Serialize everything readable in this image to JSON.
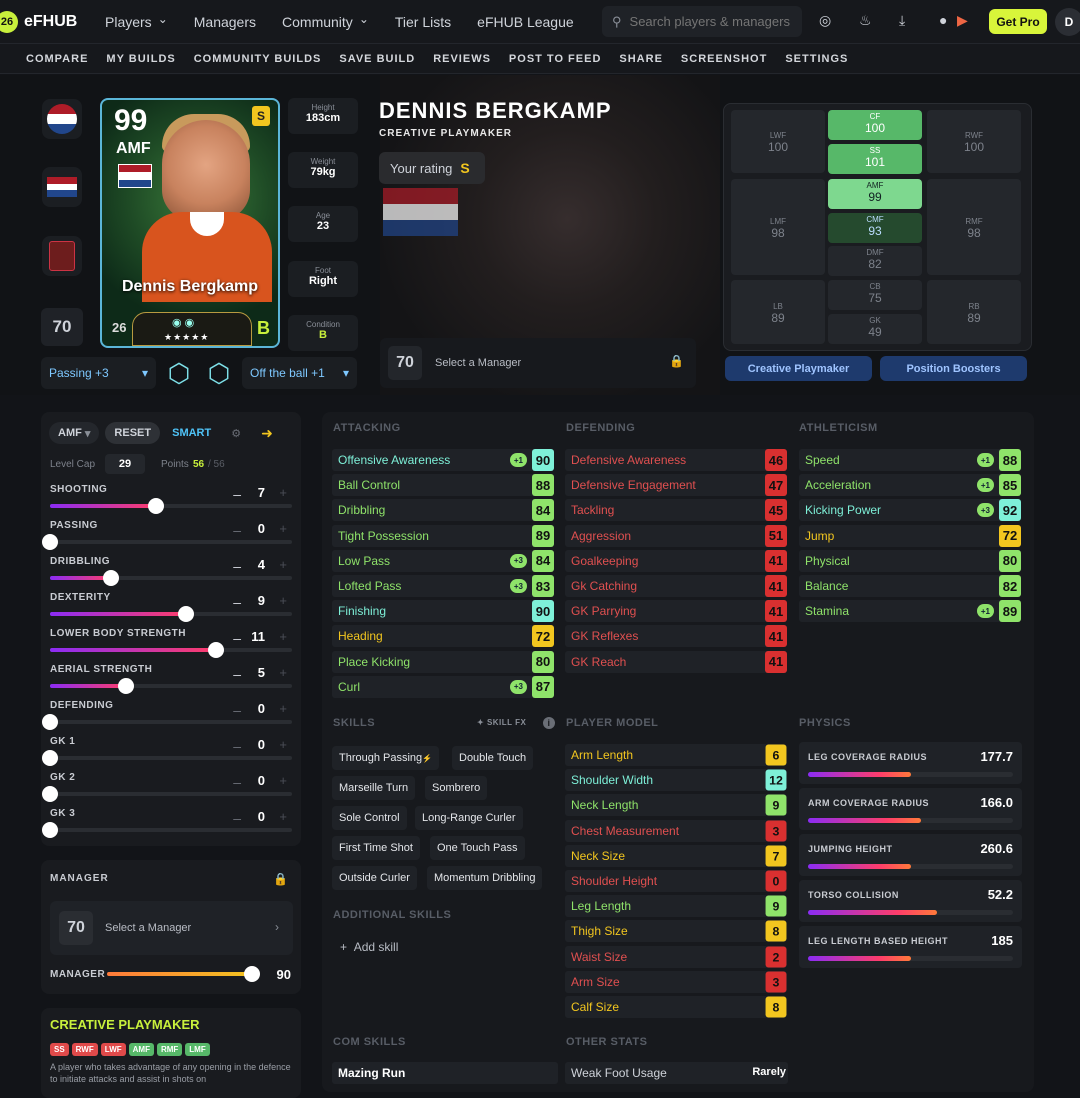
{
  "topbar": {
    "logo_mark": "26",
    "logo_text": "eFHUB",
    "nav": [
      {
        "label": "Players",
        "dropdown": true
      },
      {
        "label": "Managers",
        "dropdown": false
      },
      {
        "label": "Community",
        "dropdown": true
      },
      {
        "label": "Tier Lists",
        "dropdown": false
      },
      {
        "label": "eFHUB League",
        "dropdown": false
      }
    ],
    "search_placeholder": "Search players & managers",
    "get_pro": "Get Pro",
    "avatar": "D"
  },
  "subnav": [
    "COMPARE",
    "MY BUILDS",
    "COMMUNITY BUILDS",
    "SAVE BUILD",
    "REVIEWS",
    "POST TO FEED",
    "SHARE",
    "SCREENSHOT",
    "SETTINGS"
  ],
  "card": {
    "rating": "99",
    "position": "AMF",
    "badge": "S",
    "name": "Dennis Bergkamp",
    "year": "26",
    "condition": "B",
    "stars": "★★★★★"
  },
  "overall": "70",
  "stats": [
    {
      "label": "Height",
      "value": "183cm"
    },
    {
      "label": "Weight",
      "value": "79kg"
    },
    {
      "label": "Age",
      "value": "23"
    },
    {
      "label": "Foot",
      "value": "Right"
    },
    {
      "label": "Condition",
      "value": "B"
    }
  ],
  "booster_left": "Passing +3",
  "booster_right": "Off the ball +1",
  "player": {
    "name": "DENNIS BERGKAMP",
    "role": "CREATIVE PLAYMAKER",
    "your_rating_label": "Your rating",
    "your_rating": "S"
  },
  "manager_select": {
    "value": "70",
    "label": "Select a Manager"
  },
  "positions": {
    "LWF": "100",
    "CF": "100",
    "SS": "101",
    "RWF": "100",
    "LMF": "98",
    "AMF": "99",
    "CMF": "93",
    "RMF": "98",
    "DMF": "82",
    "LB": "89",
    "CB": "75",
    "RB": "89",
    "GK": "49"
  },
  "position_buttons": [
    "Creative Playmaker",
    "Position Boosters"
  ],
  "build": {
    "position": "AMF",
    "reset": "RESET",
    "smart": "SMART",
    "level_cap_label": "Level Cap",
    "level_cap": "29",
    "points_label": "Points",
    "points_used": "56",
    "points_total": "/ 56",
    "skills": [
      {
        "name": "SHOOTING",
        "value": 7,
        "active": true
      },
      {
        "name": "PASSING",
        "value": 0,
        "active": false
      },
      {
        "name": "DRIBBLING",
        "value": 4,
        "active": true
      },
      {
        "name": "DEXTERITY",
        "value": 9,
        "active": true
      },
      {
        "name": "LOWER BODY STRENGTH",
        "value": 11,
        "active": true
      },
      {
        "name": "AERIAL STRENGTH",
        "value": 5,
        "active": true
      },
      {
        "name": "DEFENDING",
        "value": 0,
        "active": false
      },
      {
        "name": "GK 1",
        "value": 0,
        "active": false
      },
      {
        "name": "GK 2",
        "value": 0,
        "active": false
      },
      {
        "name": "GK 3",
        "value": 0,
        "active": false
      }
    ]
  },
  "manager_panel": {
    "title": "MANAGER",
    "value": "70",
    "select": "Select a Manager",
    "slider_label": "MANAGER",
    "slider_value": "90"
  },
  "playstyle": {
    "title": "CREATIVE PLAYMAKER",
    "tags": [
      {
        "t": "SS",
        "c": "#e04a4a"
      },
      {
        "t": "RWF",
        "c": "#e04a4a"
      },
      {
        "t": "LWF",
        "c": "#e04a4a"
      },
      {
        "t": "AMF",
        "c": "#57b869"
      },
      {
        "t": "RMF",
        "c": "#57b869"
      },
      {
        "t": "LMF",
        "c": "#57b869"
      }
    ],
    "desc": "A player who takes advantage of any opening in the defence to initiate attacks and assist in shots on"
  },
  "attacking": {
    "title": "ATTACKING",
    "rows": [
      {
        "n": "Offensive Awareness",
        "v": "90",
        "b": "+1"
      },
      {
        "n": "Ball Control",
        "v": "88"
      },
      {
        "n": "Dribbling",
        "v": "84"
      },
      {
        "n": "Tight Possession",
        "v": "89"
      },
      {
        "n": "Low Pass",
        "v": "84",
        "b": "+3"
      },
      {
        "n": "Lofted Pass",
        "v": "83",
        "b": "+3"
      },
      {
        "n": "Finishing",
        "v": "90"
      },
      {
        "n": "Heading",
        "v": "72"
      },
      {
        "n": "Place Kicking",
        "v": "80"
      },
      {
        "n": "Curl",
        "v": "87",
        "b": "+3"
      }
    ]
  },
  "defending": {
    "title": "DEFENDING",
    "rows": [
      {
        "n": "Defensive Awareness",
        "v": "46"
      },
      {
        "n": "Defensive Engagement",
        "v": "47"
      },
      {
        "n": "Tackling",
        "v": "45"
      },
      {
        "n": "Aggression",
        "v": "51"
      },
      {
        "n": "Goalkeeping",
        "v": "41"
      },
      {
        "n": "Gk Catching",
        "v": "41"
      },
      {
        "n": "GK Parrying",
        "v": "41"
      },
      {
        "n": "GK Reflexes",
        "v": "41"
      },
      {
        "n": "GK Reach",
        "v": "41"
      }
    ]
  },
  "athleticism": {
    "title": "ATHLETICISM",
    "rows": [
      {
        "n": "Speed",
        "v": "88",
        "b": "+1"
      },
      {
        "n": "Acceleration",
        "v": "85",
        "b": "+1"
      },
      {
        "n": "Kicking Power",
        "v": "92",
        "b": "+3"
      },
      {
        "n": "Jump",
        "v": "72"
      },
      {
        "n": "Physical",
        "v": "80"
      },
      {
        "n": "Balance",
        "v": "82"
      },
      {
        "n": "Stamina",
        "v": "89",
        "b": "+1"
      }
    ]
  },
  "skills_section": {
    "title": "SKILLS",
    "fx": "SKILL FX",
    "items": [
      "Through Passing",
      "Double Touch",
      "Marseille Turn",
      "Sombrero",
      "Sole Control",
      "Long-Range Curler",
      "First Time Shot",
      "One Touch Pass",
      "Outside Curler",
      "Momentum Dribbling"
    ],
    "additional_title": "ADDITIONAL SKILLS",
    "add_skill": "Add skill"
  },
  "player_model": {
    "title": "PLAYER MODEL",
    "rows": [
      {
        "n": "Arm Length",
        "v": "6"
      },
      {
        "n": "Shoulder Width",
        "v": "12"
      },
      {
        "n": "Neck Length",
        "v": "9"
      },
      {
        "n": "Chest Measurement",
        "v": "3"
      },
      {
        "n": "Neck Size",
        "v": "7"
      },
      {
        "n": "Shoulder Height",
        "v": "0"
      },
      {
        "n": "Leg Length",
        "v": "9"
      },
      {
        "n": "Thigh Size",
        "v": "8"
      },
      {
        "n": "Waist Size",
        "v": "2"
      },
      {
        "n": "Arm Size",
        "v": "3"
      },
      {
        "n": "Calf Size",
        "v": "8"
      }
    ]
  },
  "physics": {
    "title": "PHYSICS",
    "rows": [
      {
        "n": "LEG COVERAGE RADIUS",
        "v": "177.7",
        "f": 0.5
      },
      {
        "n": "ARM COVERAGE RADIUS",
        "v": "166.0",
        "f": 0.55
      },
      {
        "n": "JUMPING HEIGHT",
        "v": "260.6",
        "f": 0.5
      },
      {
        "n": "TORSO COLLISION",
        "v": "52.2",
        "f": 0.63
      },
      {
        "n": "LEG LENGTH BASED HEIGHT",
        "v": "185",
        "f": 0.5
      }
    ]
  },
  "com_skills": {
    "title": "COM SKILLS",
    "items": [
      "Mazing Run"
    ]
  },
  "other_stats": {
    "title": "OTHER STATS",
    "rows": [
      {
        "n": "Weak Foot Usage",
        "v": "Rarely"
      }
    ]
  },
  "colors": {
    "accent": "#d8f53a",
    "high": "#8fe36a",
    "mid": "#f2c61f",
    "low": "#d93030",
    "top": "#7ef0d8"
  }
}
